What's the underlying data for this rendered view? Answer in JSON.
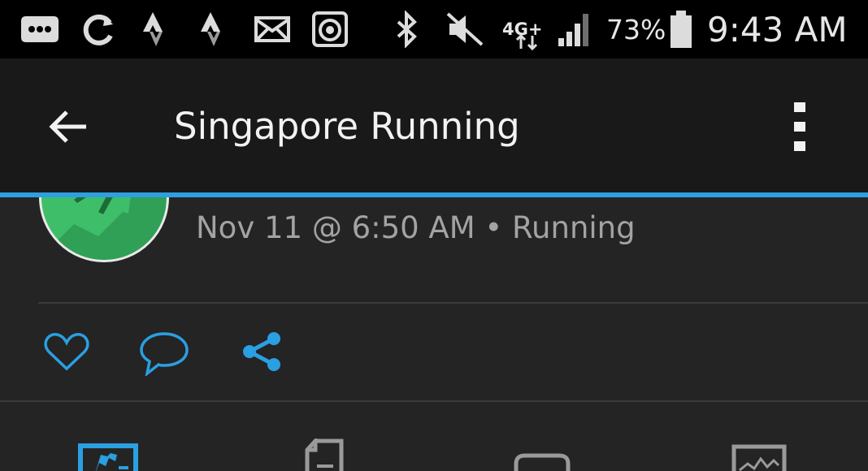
{
  "status_bar": {
    "time": "9:43 AM",
    "battery_percent": "73%",
    "network_type": "4G+",
    "icons": [
      "more-icon",
      "sync-icon",
      "strava-icon",
      "strava-icon",
      "mail-icon",
      "camera-icon",
      "bluetooth-icon",
      "mute-icon",
      "network-icon",
      "signal-icon",
      "battery-icon"
    ]
  },
  "app_bar": {
    "title": "Singapore Running",
    "back_icon": "arrow-left-icon",
    "overflow_icon": "more-vertical-icon"
  },
  "activity": {
    "meta": "Nov 11 @ 6:50 AM • Running",
    "avatar_icon": "runner-icon"
  },
  "actions": [
    "heart-icon",
    "comment-icon",
    "share-icon"
  ],
  "tabs": [
    "activity-tab-icon",
    "details-tab-icon",
    "comments-tab-icon",
    "analysis-tab-icon"
  ],
  "colors": {
    "accent": "#2f9fe0",
    "app_bar": "#191919",
    "background": "#242424",
    "status_bar": "#000000",
    "avatar": "#3fbe6a"
  }
}
